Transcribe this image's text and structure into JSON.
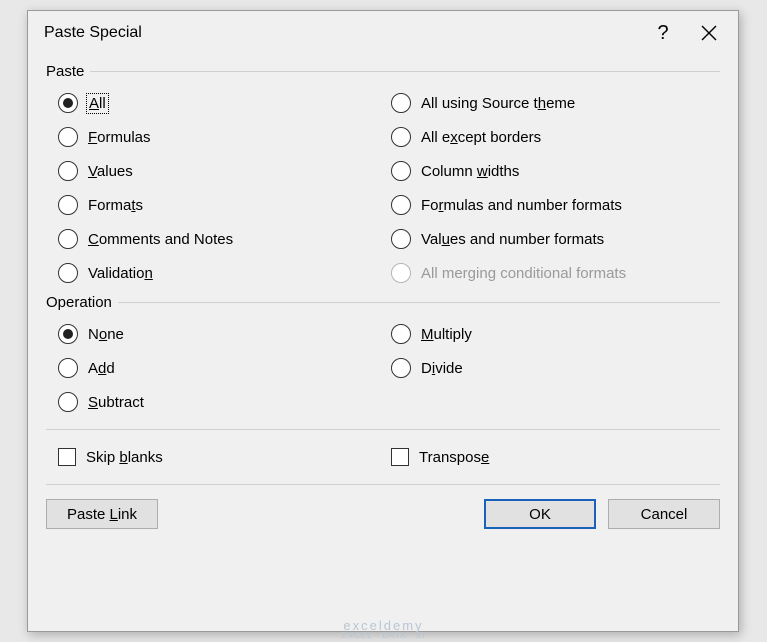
{
  "dialog": {
    "title": "Paste Special",
    "help_char": "?",
    "groups": {
      "paste": {
        "label": "Paste",
        "left": [
          {
            "pre": "",
            "u": "A",
            "post": "ll",
            "checked": true,
            "focus": true
          },
          {
            "pre": "",
            "u": "F",
            "post": "ormulas",
            "checked": false
          },
          {
            "pre": "",
            "u": "V",
            "post": "alues",
            "checked": false
          },
          {
            "pre": "Forma",
            "u": "t",
            "post": "s",
            "checked": false
          },
          {
            "pre": "",
            "u": "C",
            "post": "omments and Notes",
            "checked": false
          },
          {
            "pre": "Validatio",
            "u": "n",
            "post": "",
            "checked": false
          }
        ],
        "right": [
          {
            "pre": "All using Source t",
            "u": "h",
            "post": "eme",
            "checked": false
          },
          {
            "pre": "All e",
            "u": "x",
            "post": "cept borders",
            "checked": false
          },
          {
            "pre": "Column ",
            "u": "w",
            "post": "idths",
            "checked": false
          },
          {
            "pre": "Fo",
            "u": "r",
            "post": "mulas and number formats",
            "checked": false
          },
          {
            "pre": "Val",
            "u": "u",
            "post": "es and number formats",
            "checked": false
          },
          {
            "pre": "All mer",
            "u": "g",
            "post": "ing conditional formats",
            "checked": false,
            "disabled": true
          }
        ]
      },
      "operation": {
        "label": "Operation",
        "left": [
          {
            "pre": "N",
            "u": "o",
            "post": "ne",
            "checked": true
          },
          {
            "pre": "A",
            "u": "d",
            "post": "d",
            "checked": false
          },
          {
            "pre": "",
            "u": "S",
            "post": "ubtract",
            "checked": false
          }
        ],
        "right": [
          {
            "pre": "",
            "u": "M",
            "post": "ultiply",
            "checked": false
          },
          {
            "pre": "D",
            "u": "i",
            "post": "vide",
            "checked": false
          }
        ]
      }
    },
    "checks": {
      "skip": {
        "pre": "Skip ",
        "u": "b",
        "post": "lanks",
        "checked": false
      },
      "transpose": {
        "pre": "Transpos",
        "u": "e",
        "post": "",
        "checked": false
      }
    },
    "buttons": {
      "paste_link": "Paste Link",
      "ok": "OK",
      "cancel": "Cancel"
    }
  },
  "watermark": {
    "main": "exceldemy",
    "sub": "EXCEL · DATA · BI"
  }
}
